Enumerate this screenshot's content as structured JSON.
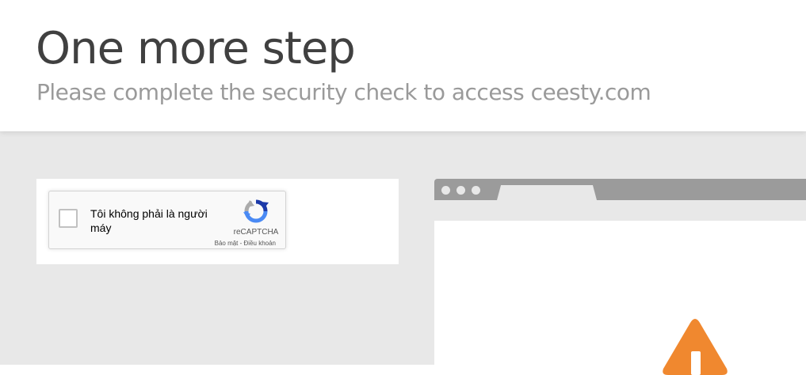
{
  "header": {
    "title": "One more step",
    "subtitle": "Please complete the security check to access ceesty.com"
  },
  "captcha": {
    "label": "Tôi không phải là người máy",
    "brand": "reCAPTCHA",
    "privacy_link": "Bảo mật",
    "separator": " - ",
    "terms_link": "Điều khoản",
    "logo_icon": "recaptcha-logo-icon"
  },
  "browser_illustration": {
    "warning_icon": "warning-triangle-icon",
    "warning_color": "#f0882f",
    "chrome_color": "#9b9b9b"
  },
  "colors": {
    "content_background": "#e8e8e8",
    "title": "#404040",
    "subtitle": "#9a9a9a"
  }
}
